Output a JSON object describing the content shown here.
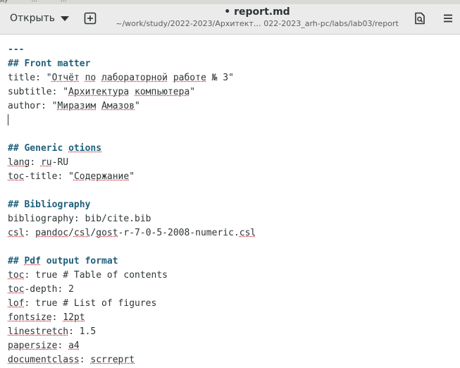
{
  "open_label": "Открыть",
  "title": "• report.md",
  "path": "~/work/study/2022-2023/Архитект… 022-2023_arh-pc/labs/lab03/report",
  "top_strip": [
    "ду",
    "...",
    "..."
  ],
  "lines": [
    {
      "spans": [
        {
          "t": "---",
          "c": "hdr"
        }
      ]
    },
    {
      "spans": [
        {
          "t": "## Front matter",
          "c": "hdr"
        }
      ]
    },
    {
      "spans": [
        {
          "t": "title: \""
        },
        {
          "t": "Отчёт",
          "c": "sp"
        },
        {
          "t": " "
        },
        {
          "t": "по",
          "c": "sp"
        },
        {
          "t": " "
        },
        {
          "t": "лабораторной",
          "c": "sp"
        },
        {
          "t": " "
        },
        {
          "t": "работе",
          "c": "sp"
        },
        {
          "t": " № 3\""
        }
      ]
    },
    {
      "spans": [
        {
          "t": "subtitle: \""
        },
        {
          "t": "Архитектура",
          "c": "sp"
        },
        {
          "t": " "
        },
        {
          "t": "компьютера",
          "c": "sp"
        },
        {
          "t": "\""
        }
      ]
    },
    {
      "spans": [
        {
          "t": "author: \""
        },
        {
          "t": "Миразим",
          "c": "sp"
        },
        {
          "t": " "
        },
        {
          "t": "Амазов",
          "c": "sp"
        },
        {
          "t": "\""
        }
      ]
    },
    {
      "spans": []
    },
    {
      "spans": []
    },
    {
      "spans": [
        {
          "t": "## Generic ",
          "c": "hdr"
        },
        {
          "t": "otions",
          "c": "hdr sp"
        }
      ]
    },
    {
      "spans": [
        {
          "t": "lang",
          "c": "sp"
        },
        {
          "t": ": "
        },
        {
          "t": "ru",
          "c": "sp"
        },
        {
          "t": "-RU"
        }
      ]
    },
    {
      "spans": [
        {
          "t": "toc",
          "c": "sp"
        },
        {
          "t": "-title: \""
        },
        {
          "t": "Содержание",
          "c": "sp"
        },
        {
          "t": "\""
        }
      ]
    },
    {
      "spans": []
    },
    {
      "spans": [
        {
          "t": "## Bibliography",
          "c": "hdr"
        }
      ]
    },
    {
      "spans": [
        {
          "t": "bibliography: bib/cite.bib"
        }
      ]
    },
    {
      "spans": [
        {
          "t": "csl",
          "c": "sp"
        },
        {
          "t": ": "
        },
        {
          "t": "pandoc",
          "c": "sp"
        },
        {
          "t": "/"
        },
        {
          "t": "csl",
          "c": "sp"
        },
        {
          "t": "/"
        },
        {
          "t": "gost",
          "c": "sp"
        },
        {
          "t": "-r-7-0-5-2008-numeric."
        },
        {
          "t": "csl",
          "c": "sp"
        }
      ]
    },
    {
      "spans": []
    },
    {
      "spans": [
        {
          "t": "## ",
          "c": "hdr"
        },
        {
          "t": "Pdf",
          "c": "hdr sp"
        },
        {
          "t": " output format",
          "c": "hdr"
        }
      ]
    },
    {
      "spans": [
        {
          "t": "toc",
          "c": "sp"
        },
        {
          "t": ": true # Table of contents"
        }
      ]
    },
    {
      "spans": [
        {
          "t": "toc",
          "c": "sp"
        },
        {
          "t": "-depth: 2"
        }
      ]
    },
    {
      "spans": [
        {
          "t": "lof",
          "c": "sp"
        },
        {
          "t": ": true # List of figures"
        }
      ]
    },
    {
      "spans": [
        {
          "t": "fontsize",
          "c": "sp"
        },
        {
          "t": ": "
        },
        {
          "t": "12pt",
          "c": "sp"
        }
      ]
    },
    {
      "spans": [
        {
          "t": "linestretch",
          "c": "sp"
        },
        {
          "t": ": 1.5"
        }
      ]
    },
    {
      "spans": [
        {
          "t": "papersize",
          "c": "sp"
        },
        {
          "t": ": "
        },
        {
          "t": "a4",
          "c": "sp"
        }
      ]
    },
    {
      "spans": [
        {
          "t": "documentclass",
          "c": "sp"
        },
        {
          "t": ": "
        },
        {
          "t": "scrreprt",
          "c": "sp"
        }
      ]
    }
  ],
  "icons": {
    "new_tab": "new-tab-icon",
    "save": "save-icon",
    "menu": "hamburger-menu-icon"
  }
}
